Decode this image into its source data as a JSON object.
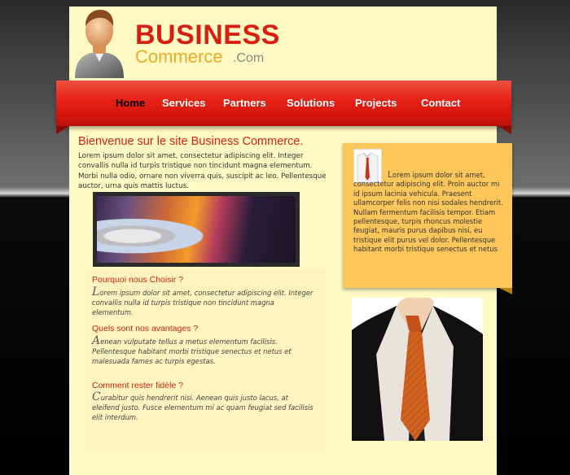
{
  "logo": {
    "business": "BUSINESS",
    "commerce": "Commerce",
    "com": ".Com"
  },
  "nav": {
    "items": [
      "Home",
      "Services",
      "Partners",
      "Solutions",
      "Projects",
      "Contact"
    ],
    "active": "Home"
  },
  "main": {
    "welcome": "Bienvenue sur le site Business Commerce.",
    "intro": "Lorem ipsum dolor sit amet, consectetur adipiscing elit. Integer convallis nulla id turpis tristique non tincidunt magna elementum. Morbi nulla odio, ornare non viverra quis, suscipit ac leo. Pellentesque auctor, urna quis mattis luctus."
  },
  "features": [
    {
      "title": "Pourquoi nous Choisir ?",
      "initial": "L",
      "text": "orem ipsum dolor sit amet, consectetur adipiscing elit. Integer convallis nulla id turpis tristique non tincidunt magna elementum."
    },
    {
      "title": "Quels sont nos avantages ?",
      "initial": "A",
      "text": "enean vulputate tellus a metus elementum facilisis. Pellentesque habitant morbi tristique senectus et netus et malesuada fames ac turpis egestas."
    },
    {
      "title": "Comment rester fidèle ?",
      "initial": "C",
      "text": "urabitur quis hendrerit nisi. Aenean quis justo lacus, at eleifend justo. Fusce elementum mi ac quam feugiat sed facilisis elit interdum."
    }
  ],
  "sidebar": {
    "initial": "L",
    "text": "orem ipsum dolor sit amet, consectetur adipiscing elit. Proin auctor mi id ipsum lacinia vehicula. Praesent ullamcorper felis non nisi sodales hendrerit. Nullam fermentum facilisis tempor. Etiam pellentesque, turpis rhoncus molestie feugiat, mauris purus dapibus nisi, eu tristique elit purus vel dolor. Pellentesque habitant morbi tristique senectus et netus"
  },
  "colors": {
    "brand_red": "#d71f10",
    "brand_orange": "#efaa22",
    "page_bg": "#fff9c4",
    "sidebar_bg": "#fdc65a"
  },
  "icons": [
    "user-avatar-icon",
    "shirt-tie-icon"
  ]
}
